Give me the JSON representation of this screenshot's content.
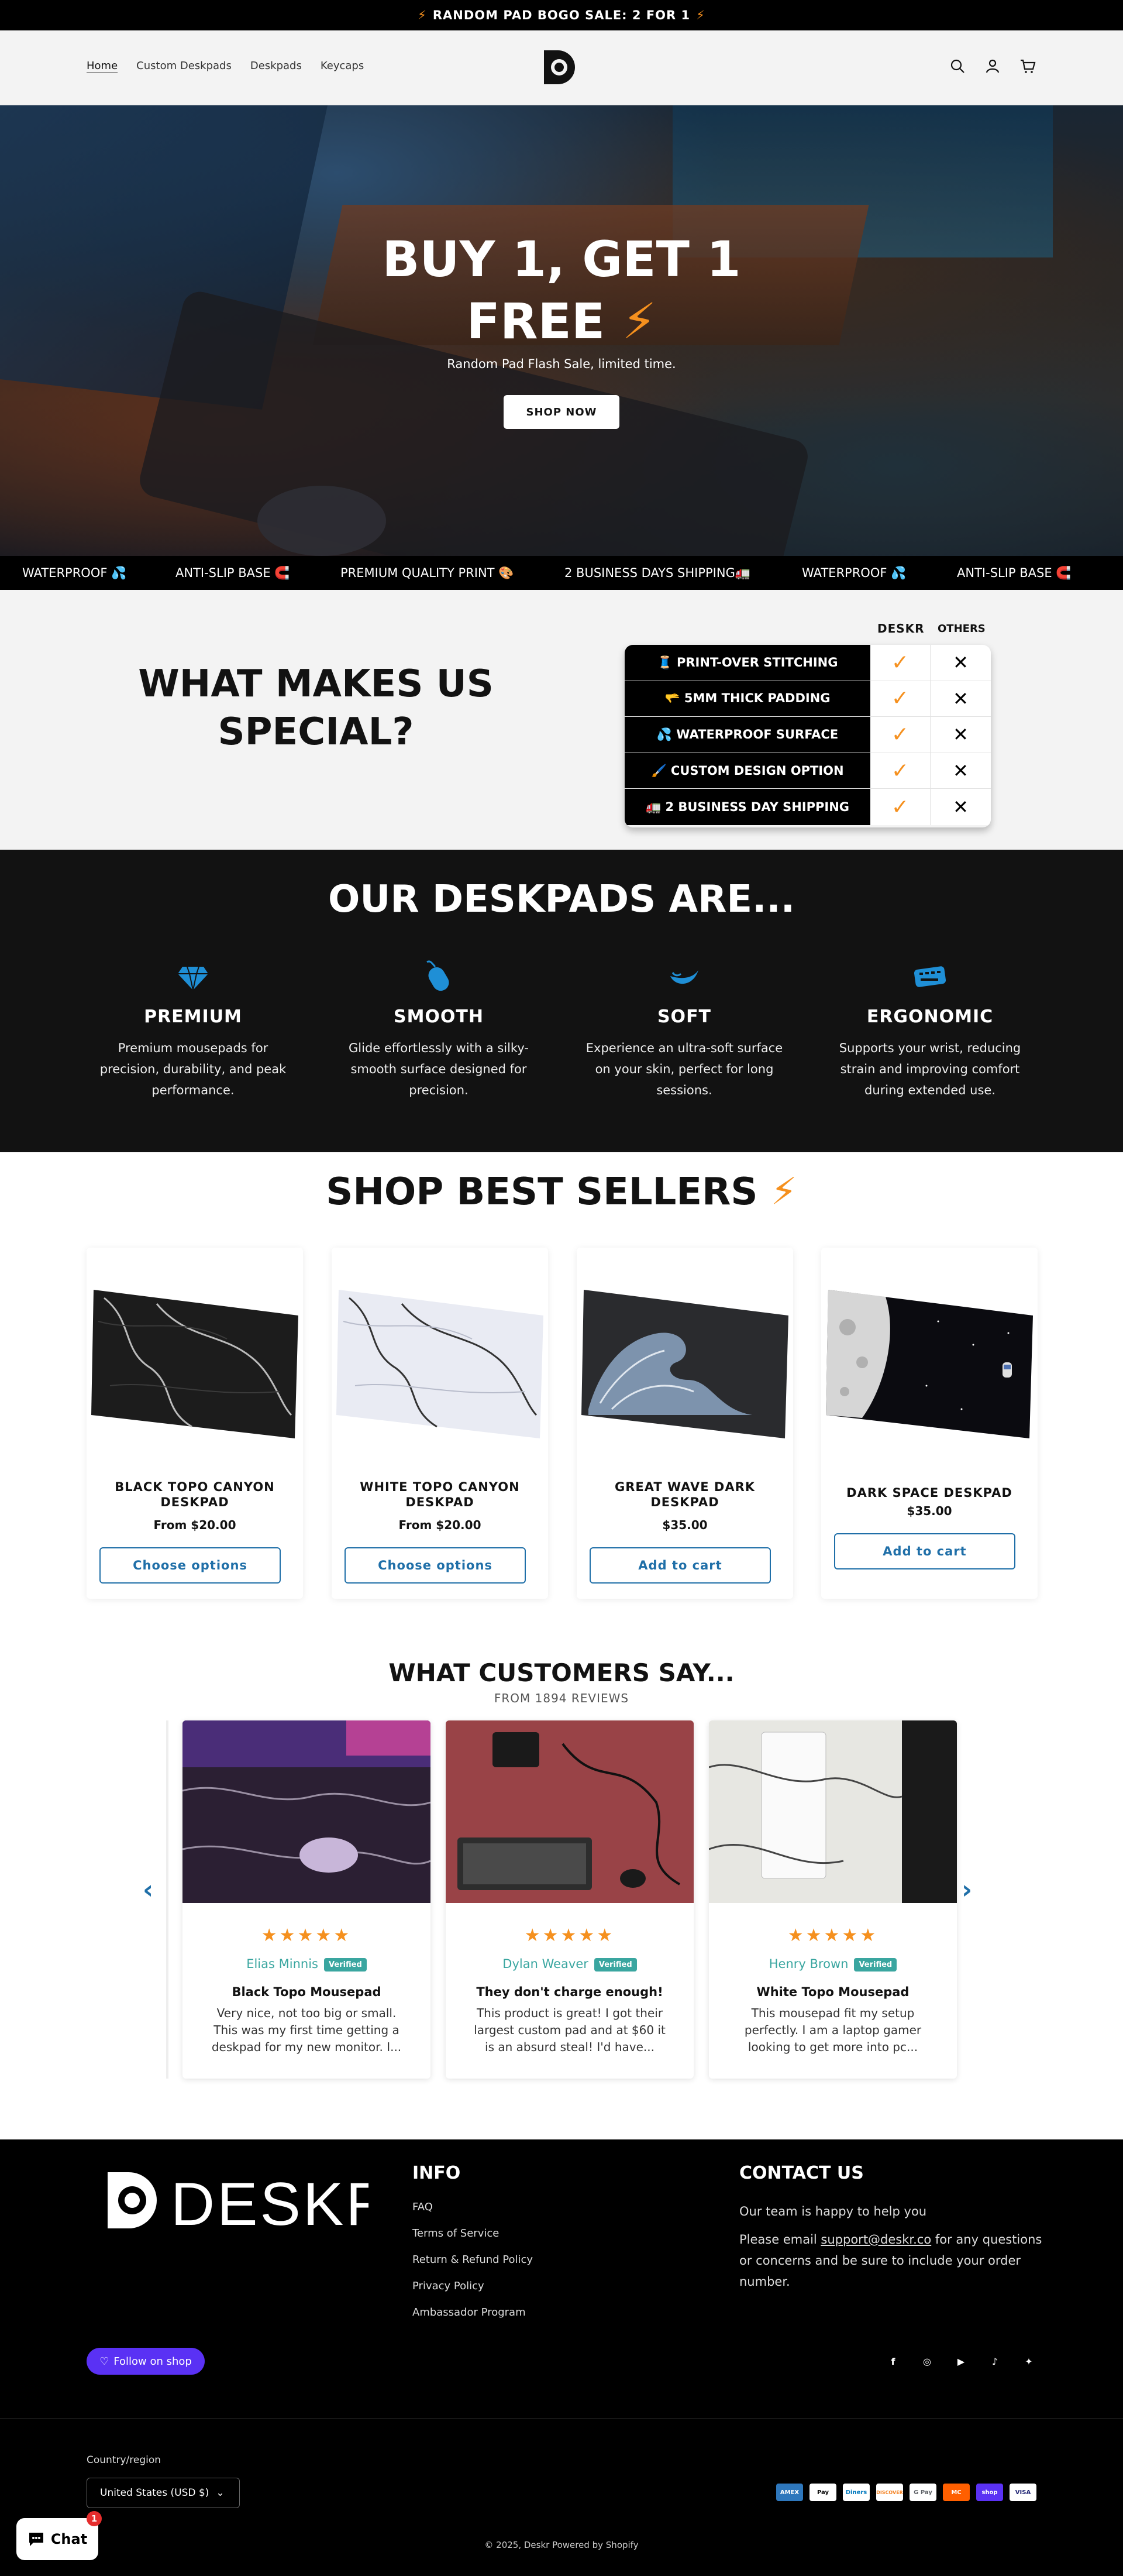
{
  "announcement": {
    "text": "RANDOM PAD BOGO SALE: 2 FOR 1",
    "bolt": "⚡"
  },
  "nav": {
    "items": [
      "Home",
      "Custom Deskpads",
      "Deskpads",
      "Keycaps"
    ]
  },
  "hero": {
    "title_line1": "BUY 1, GET 1",
    "title_line2": "FREE",
    "bolt": "⚡",
    "subtitle": "Random Pad Flash Sale, limited time.",
    "button": "SHOP NOW"
  },
  "ticker": [
    "WATERPROOF 💦",
    "ANTI-SLIP BASE 🧲",
    "PREMIUM QUALITY PRINT 🎨",
    "2 BUSINESS DAYS SHIPPING🚛",
    "WATERPROOF 💦",
    "ANTI-SLIP BASE 🧲"
  ],
  "special": {
    "title": "WHAT MAKES US SPECIAL?",
    "col_deskr": "DESKR",
    "col_others": "OTHERS",
    "rows": [
      "🧵 PRINT-OVER STITCHING",
      "🫳 5MM THICK PADDING",
      "💦 WATERPROOF SURFACE",
      "🖌️ CUSTOM DESIGN OPTION",
      "🚛 2 BUSINESS DAY SHIPPING"
    ],
    "check": "✓",
    "cross": "✕"
  },
  "features": {
    "title": "OUR DESKPADS ARE...",
    "items": [
      {
        "title": "PREMIUM",
        "text": "Premium mousepads for precision, durability, and peak performance.",
        "icon": "diamond-icon"
      },
      {
        "title": "SMOOTH",
        "text": "Glide effortlessly with a silky-smooth surface designed for precision.",
        "icon": "mouse-icon"
      },
      {
        "title": "SOFT",
        "text": "Experience an ultra-soft surface on your skin, perfect for long sessions.",
        "icon": "feather-icon"
      },
      {
        "title": "ERGONOMIC",
        "text": "Supports your wrist, reducing strain and improving comfort during extended use.",
        "icon": "keyboard-icon"
      }
    ]
  },
  "sellers": {
    "title": "SHOP BEST SELLERS",
    "bolt": "⚡",
    "products": [
      {
        "name": "BLACK TOPO CANYON DESKPAD",
        "price": "From $20.00",
        "button": "Choose options"
      },
      {
        "name": "WHITE TOPO CANYON DESKPAD",
        "price": "From $20.00",
        "button": "Choose options"
      },
      {
        "name": "GREAT WAVE DARK DESKPAD",
        "price": "$35.00",
        "button": "Add to cart"
      },
      {
        "name": "DARK SPACE DESKPAD",
        "price": "$35.00",
        "button": "Add to cart"
      }
    ]
  },
  "reviews": {
    "title": "WHAT CUSTOMERS SAY...",
    "subtitle": "FROM 1894 REVIEWS",
    "stars": "★★★★★",
    "verified": "Verified",
    "prev": "‹",
    "next": "›",
    "items": [
      {
        "name": "Elias Minnis",
        "title": "Black Topo Mousepad",
        "body": "Very nice, not too big or small. This was my first time getting a deskpad for my new monitor. I..."
      },
      {
        "name": "Dylan Weaver",
        "title": "They don't charge enough!",
        "body": "This product is great! I got their largest custom pad and at $60 it is an absurd steal! I'd have..."
      },
      {
        "name": "Henry Brown",
        "title": "White Topo Mousepad",
        "body": "This mousepad fit my setup perfectly. I am a laptop gamer looking to get more into pc..."
      }
    ]
  },
  "footer": {
    "logo": "DESKR",
    "info_title": "INFO",
    "links": [
      "FAQ",
      "Terms of Service",
      "Return & Refund Policy",
      "Privacy Policy",
      "Ambassador Program"
    ],
    "contact_title": "CONTACT US",
    "contact_p1": "Our team is happy to help you",
    "contact_p2a": "Please email ",
    "contact_email": "support@deskr.co",
    "contact_p2b": " for any questions or concerns and be sure to include your order number.",
    "follow": "Follow on shop",
    "country_label": "Country/region",
    "country_value": "United States (USD $)",
    "payments": [
      "AMEX",
      "Pay",
      "Diners",
      "DISCOVER",
      "G Pay",
      "MC",
      "shop",
      "VISA"
    ],
    "copyright": "© 2025, Deskr Powered by Shopify"
  },
  "chat": {
    "label": "Chat",
    "badge": "1"
  },
  "colors": {
    "accent": "#f5901e",
    "link": "#1f6fa8",
    "verified": "#3aa6a0",
    "shop": "#5a31f4"
  }
}
